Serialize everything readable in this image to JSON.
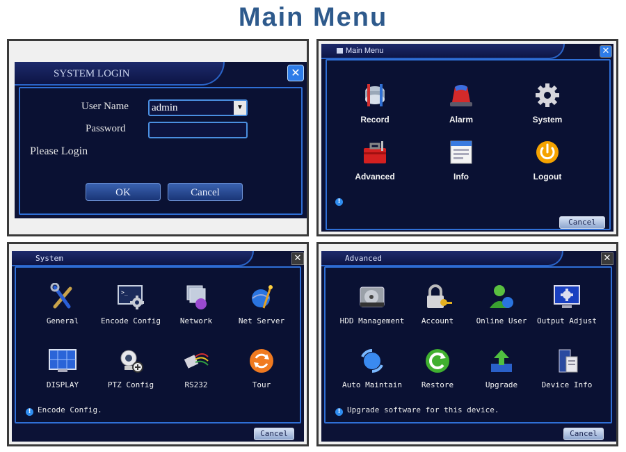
{
  "page": {
    "title": "Main Menu"
  },
  "login": {
    "title": "SYSTEM LOGIN",
    "username_label": "User Name",
    "username_value": "admin",
    "password_label": "Password",
    "prompt": "Please Login",
    "ok_label": "OK",
    "cancel_label": "Cancel"
  },
  "main_menu": {
    "title": "Main Menu",
    "items": [
      {
        "label": "Record",
        "icon": "record-icon"
      },
      {
        "label": "Alarm",
        "icon": "alarm-icon"
      },
      {
        "label": "System",
        "icon": "gear-icon"
      },
      {
        "label": "Advanced",
        "icon": "toolbox-icon"
      },
      {
        "label": "Info",
        "icon": "info-window-icon"
      },
      {
        "label": "Logout",
        "icon": "power-icon"
      }
    ],
    "cancel_label": "Cancel"
  },
  "system": {
    "title": "System",
    "items": [
      {
        "label": "General",
        "icon": "tools-icon"
      },
      {
        "label": "Encode Config",
        "icon": "encode-config-icon"
      },
      {
        "label": "Network",
        "icon": "network-icon"
      },
      {
        "label": "Net Server",
        "icon": "net-server-icon"
      },
      {
        "label": "DISPLAY",
        "icon": "display-icon"
      },
      {
        "label": "PTZ Config",
        "icon": "ptz-camera-icon"
      },
      {
        "label": "RS232",
        "icon": "rs232-cable-icon"
      },
      {
        "label": "Tour",
        "icon": "tour-refresh-icon"
      }
    ],
    "status": "Encode Config.",
    "cancel_label": "Cancel"
  },
  "advanced": {
    "title": "Advanced",
    "items": [
      {
        "label": "HDD Management",
        "icon": "hdd-icon"
      },
      {
        "label": "Account",
        "icon": "lock-key-icon"
      },
      {
        "label": "Online User",
        "icon": "online-user-icon"
      },
      {
        "label": "Output Adjust",
        "icon": "output-adjust-icon"
      },
      {
        "label": "Auto Maintain",
        "icon": "auto-maintain-icon"
      },
      {
        "label": "Restore",
        "icon": "restore-icon"
      },
      {
        "label": "Upgrade",
        "icon": "upgrade-icon"
      },
      {
        "label": "Device Info",
        "icon": "device-info-icon"
      }
    ],
    "status": "Upgrade software for this device.",
    "cancel_label": "Cancel"
  }
}
